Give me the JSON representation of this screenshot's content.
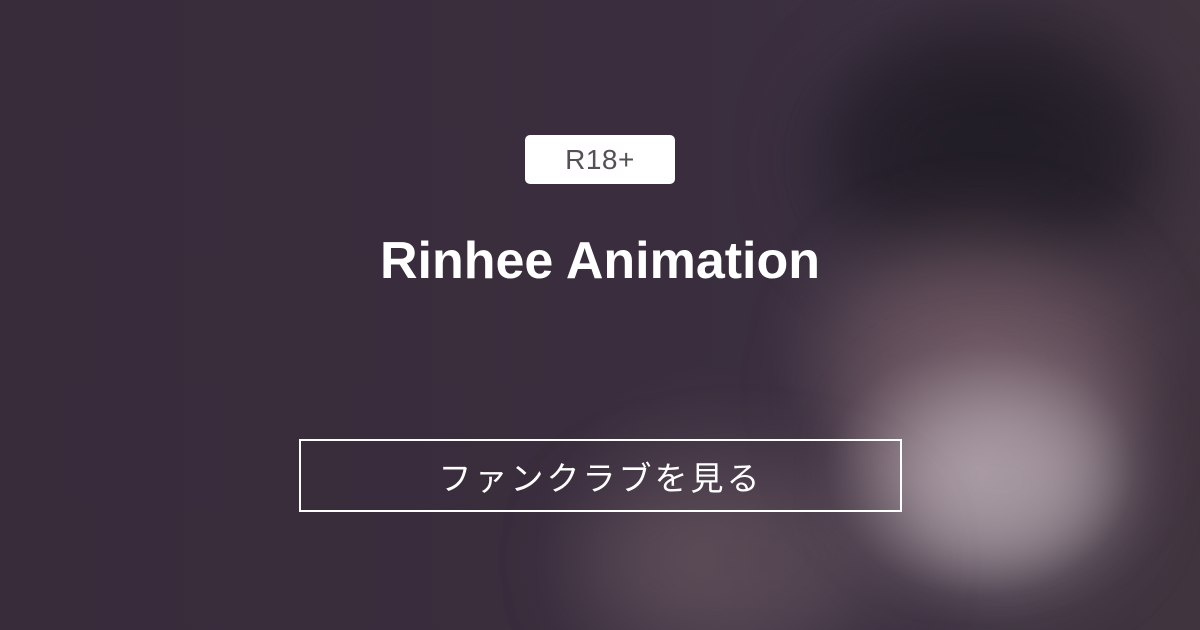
{
  "badge": {
    "label": "R18+"
  },
  "fanclub": {
    "title": "Rinhee Animation"
  },
  "cta": {
    "label": "ファンクラブを見る"
  }
}
